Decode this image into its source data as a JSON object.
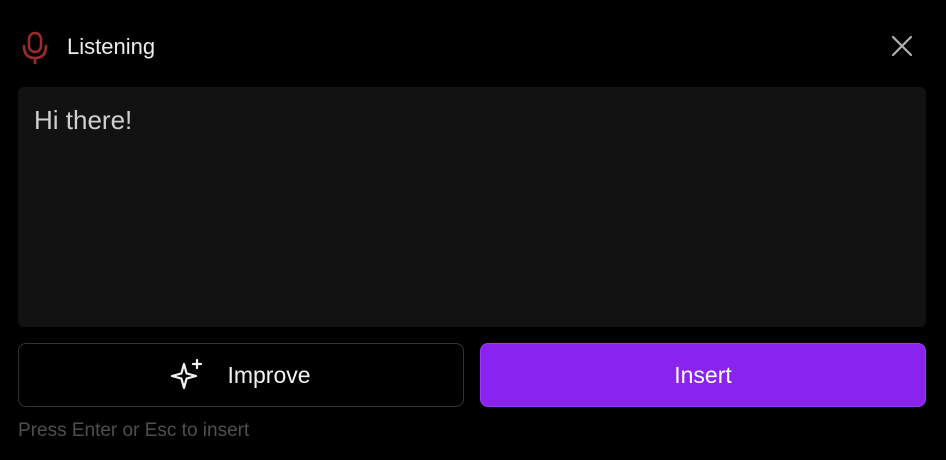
{
  "header": {
    "icon": "microphone-icon",
    "status_label": "Listening",
    "close_icon": "close-icon"
  },
  "editor": {
    "text": "Hi there!"
  },
  "actions": {
    "improve_icon": "sparkle-icon",
    "improve_label": "Improve",
    "insert_label": "Insert"
  },
  "hint": "Press Enter or Esc to insert",
  "colors": {
    "background": "#000000",
    "mic": "#9b2c2c",
    "textarea_bg": "#121212",
    "accent": "#8a22f0"
  }
}
